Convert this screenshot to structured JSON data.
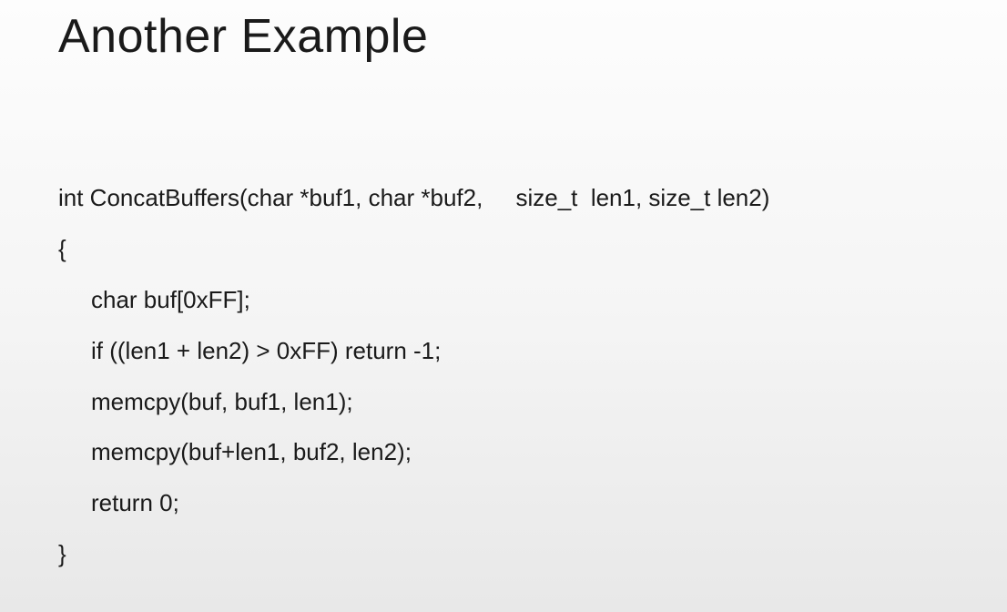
{
  "slide": {
    "title": "Another Example",
    "code": {
      "line1": "int ConcatBuffers(char *buf1, char *buf2,     size_t  len1, size_t len2)",
      "line2": "{",
      "line3": "char buf[0xFF];",
      "line4": "if ((len1 + len2) > 0xFF) return -1;",
      "line5": "memcpy(buf, buf1, len1);",
      "line6": "memcpy(buf+len1, buf2, len2);",
      "line7": "return 0;",
      "line8": "}"
    }
  }
}
